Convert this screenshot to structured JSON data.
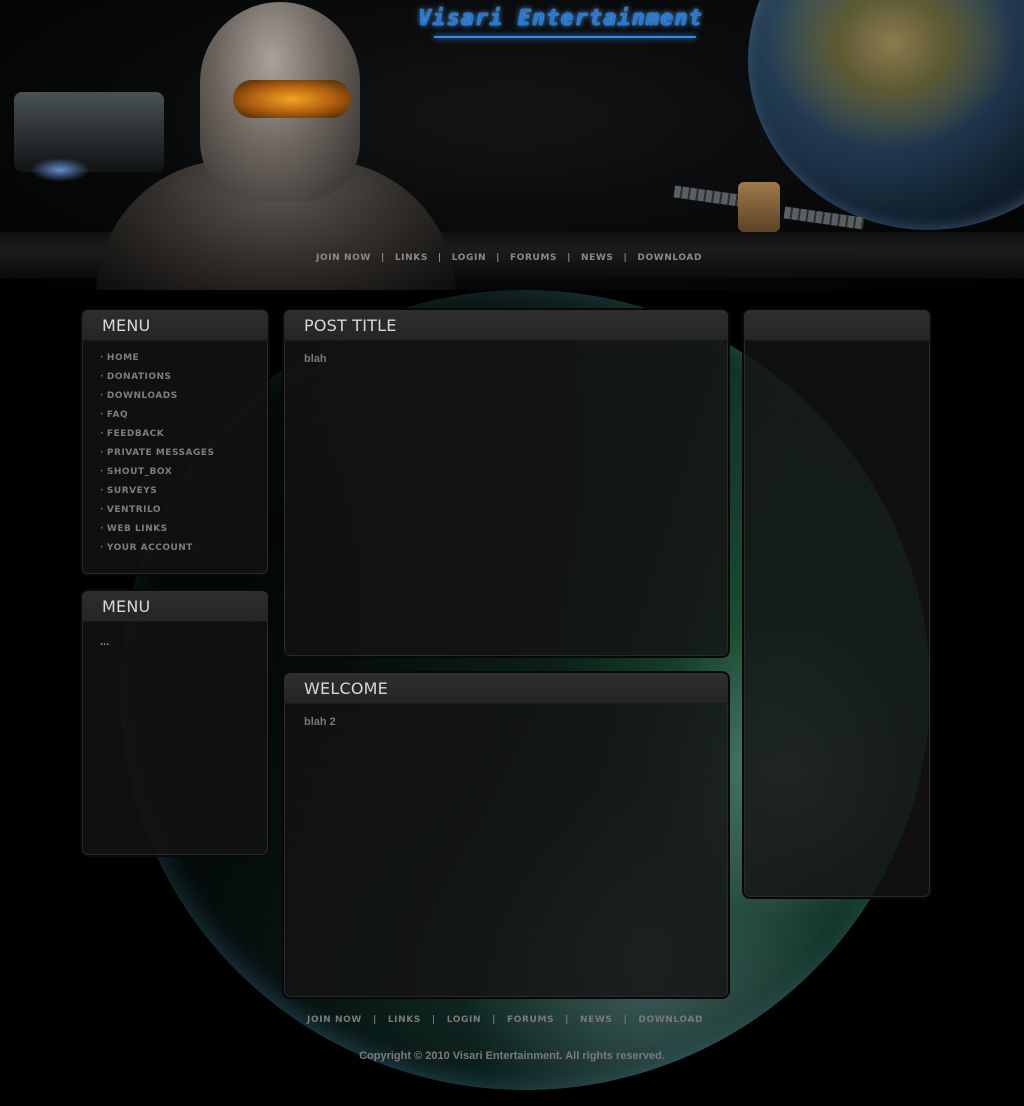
{
  "site": {
    "logo_text": "Visari Entertainment"
  },
  "topnav": {
    "items": [
      "JOIN NOW",
      "LINKS",
      "LOGIN",
      "FORUMS",
      "NEWS",
      "DOWNLOAD"
    ],
    "separator": "|"
  },
  "left_menu_1": {
    "title": "MENU",
    "bullet": "·",
    "items": [
      "HOME",
      "DONATIONS",
      "DOWNLOADS",
      "FAQ",
      "FEEDBACK",
      "PRIVATE MESSAGES",
      "SHOUT_BOX",
      "SURVEYS",
      "VENTRILO",
      "WEB LINKS",
      "YOUR ACCOUNT"
    ]
  },
  "left_menu_2": {
    "title": "MENU",
    "content": "..."
  },
  "post": {
    "title": "POST TITLE",
    "body": "blah"
  },
  "welcome": {
    "title": "WELCOME",
    "body": "blah 2"
  },
  "right_panel": {
    "title": ""
  },
  "footer": {
    "nav": [
      "JOIN NOW",
      "LINKS",
      "LOGIN",
      "FORUMS",
      "NEWS",
      "DOWNLOAD"
    ],
    "separator": "|",
    "copyright": "Copyright © 2010 Visari Entertainment. All rights reserved."
  }
}
